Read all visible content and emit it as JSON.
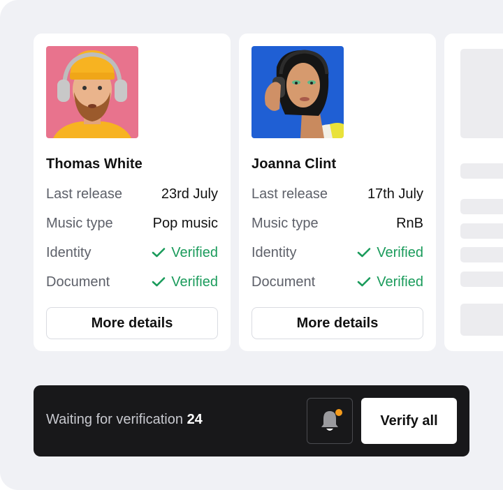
{
  "cards": [
    {
      "name": "Thomas White",
      "rows": [
        {
          "label": "Last release",
          "value": "23rd July"
        },
        {
          "label": "Music type",
          "value": "Pop music"
        },
        {
          "label": "Identity",
          "value": "Verified"
        },
        {
          "label": "Document",
          "value": "Verified"
        }
      ],
      "button": "More details",
      "photo_bg": "#e8738d"
    },
    {
      "name": "Joanna Clint",
      "rows": [
        {
          "label": "Last release",
          "value": "17th July"
        },
        {
          "label": "Music type",
          "value": "RnB"
        },
        {
          "label": "Identity",
          "value": "Verified"
        },
        {
          "label": "Document",
          "value": "Verified"
        }
      ],
      "button": "More details",
      "photo_bg": "#1f5fd4"
    }
  ],
  "footer": {
    "waiting_label": "Waiting for verification",
    "waiting_count": "24",
    "verify_button": "Verify all",
    "bell_icon": "bell-icon"
  },
  "colors": {
    "verified": "#1a9b5b",
    "notification_dot": "#f59b1c",
    "bar_bg": "#18181a"
  }
}
